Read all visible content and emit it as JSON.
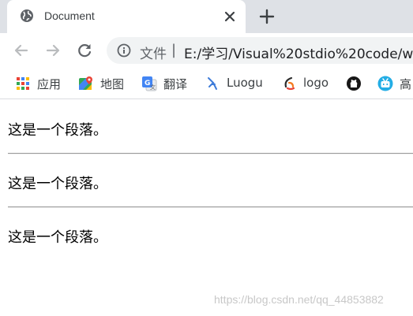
{
  "tab": {
    "title": "Document",
    "favicon": "globe-icon",
    "close_icon": "close-icon",
    "new_tab_icon": "plus-icon"
  },
  "toolbar": {
    "back_icon": "arrow-left-icon",
    "forward_icon": "arrow-right-icon",
    "reload_icon": "reload-icon",
    "site_info_icon": "info-icon",
    "site_label": "文件",
    "separator": "|",
    "url": "E:/学习/Visual%20stdio%20code/w"
  },
  "bookmarks": [
    {
      "label": "应用",
      "icon": "apps-grid-icon"
    },
    {
      "label": "地图",
      "icon": "maps-icon"
    },
    {
      "label": "翻译",
      "icon": "translate-icon"
    },
    {
      "label": "Luogu",
      "icon": "luogu-icon"
    },
    {
      "label": "logo",
      "icon": "logo-icon"
    },
    {
      "label": "",
      "icon": "github-icon"
    },
    {
      "label": "高",
      "icon": "bilibili-icon"
    }
  ],
  "page": {
    "paragraphs": [
      "这是一个段落。",
      "这是一个段落。",
      "这是一个段落。"
    ]
  },
  "watermark": "https://blog.csdn.net/qq_44853882",
  "colors": {
    "tabstrip_bg": "#dee1e6",
    "omnibox_bg": "#f1f3f4",
    "icon_gray": "#5f6368"
  }
}
